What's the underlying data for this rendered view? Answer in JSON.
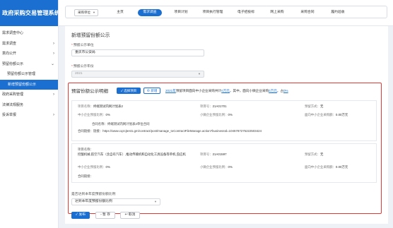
{
  "app": {
    "title": "政府采购交易管理系统"
  },
  "sidebar": {
    "items": [
      {
        "label": "需求调查中心",
        "chevron": false
      },
      {
        "label": "需求调查",
        "chevron": true
      },
      {
        "label": "意向公开",
        "chevron": true
      },
      {
        "label": "预留份额公示",
        "chevron": true
      },
      {
        "label": "预留份额公示管理",
        "chevron": false
      },
      {
        "label": "新增预留份额公示",
        "chevron": false,
        "active": true
      },
      {
        "label": "政府采购管理",
        "chevron": true
      },
      {
        "label": "法律法规服务",
        "chevron": false
      },
      {
        "label": "投诉举报",
        "chevron": true
      }
    ]
  },
  "topbar": {
    "selector": "采购单位",
    "tabs": [
      "主页",
      "需求调查",
      "项目计划",
      "项目执行管理",
      "电子招投标",
      "网上采购",
      "采购合同",
      "履约验收"
    ],
    "active_tab": "需求调查"
  },
  "form": {
    "title": "新增预留份额公示",
    "unit_label": "预留公示单位",
    "unit_value": "重庆市公安局",
    "year_label": "预留公示年份",
    "year_value": "2021"
  },
  "detail": {
    "heading": "预留份额公示明细",
    "select_btn": "选择项目",
    "new_btn": "新增",
    "summary": {
      "year": "2021年",
      "text1": "预留项目面向中小企业采购共计",
      "amt1": "0万元",
      "text2": "，其中，面向小微企业采购",
      "amt2": "0万元",
      "text3": "，占",
      "pct": "0%"
    }
  },
  "cards": [
    {
      "project_name_k": "项目名称：",
      "project_name_v": "终端测试内网计划表2",
      "project_no_k": "项目号：",
      "project_no_v": "21A01701",
      "reserve_type_k": "预留方式：",
      "reserve_type_v": "无",
      "sme_ratio_k": "中小企业预留比例：",
      "sme_ratio_v": "0%",
      "small_ratio_k": "小微企业预留比例：",
      "small_ratio_v": "0%",
      "sme_amount_k": "面向中小企业采购额：",
      "sme_amount_v": "0.00万元",
      "contract_title": "合同名称：终端测试内网计划表2单位合同",
      "contract_link_k": "合同链接：",
      "contract_link_v": "链接：https://www.cqzcjtest1.gm/contract/post/manage_toContractFileManage.action?businessId=1045787275222503424"
    },
    {
      "project_name_k": "项目名称：",
      "project_name_v": "控酸机械,航空汽车（含自有汽车）,推动传输机和自动化工具设备等单机,虫应机",
      "project_no_k": "项目号：",
      "project_no_v": "21A01597",
      "reserve_type_k": "预留方式：",
      "reserve_type_v": "无",
      "sme_ratio_k": "中小企业预留比例：",
      "sme_ratio_v": "0%",
      "small_ratio_k": "小微企业预留比例：",
      "small_ratio_v": "0%",
      "sme_amount_k": "面向中小企业采购额：",
      "sme_amount_v": "0.00万元",
      "contract_link_k": "合同链接："
    }
  ],
  "bottom": {
    "label": "是否达到本年度预留份额比例",
    "select_value": "达到本年度预留份额比例"
  },
  "actions": {
    "publish": "发布",
    "save": "暂 存",
    "cancel": "取消"
  },
  "colors": {
    "primary": "#1a6fd0",
    "highlight": "#e53935"
  }
}
